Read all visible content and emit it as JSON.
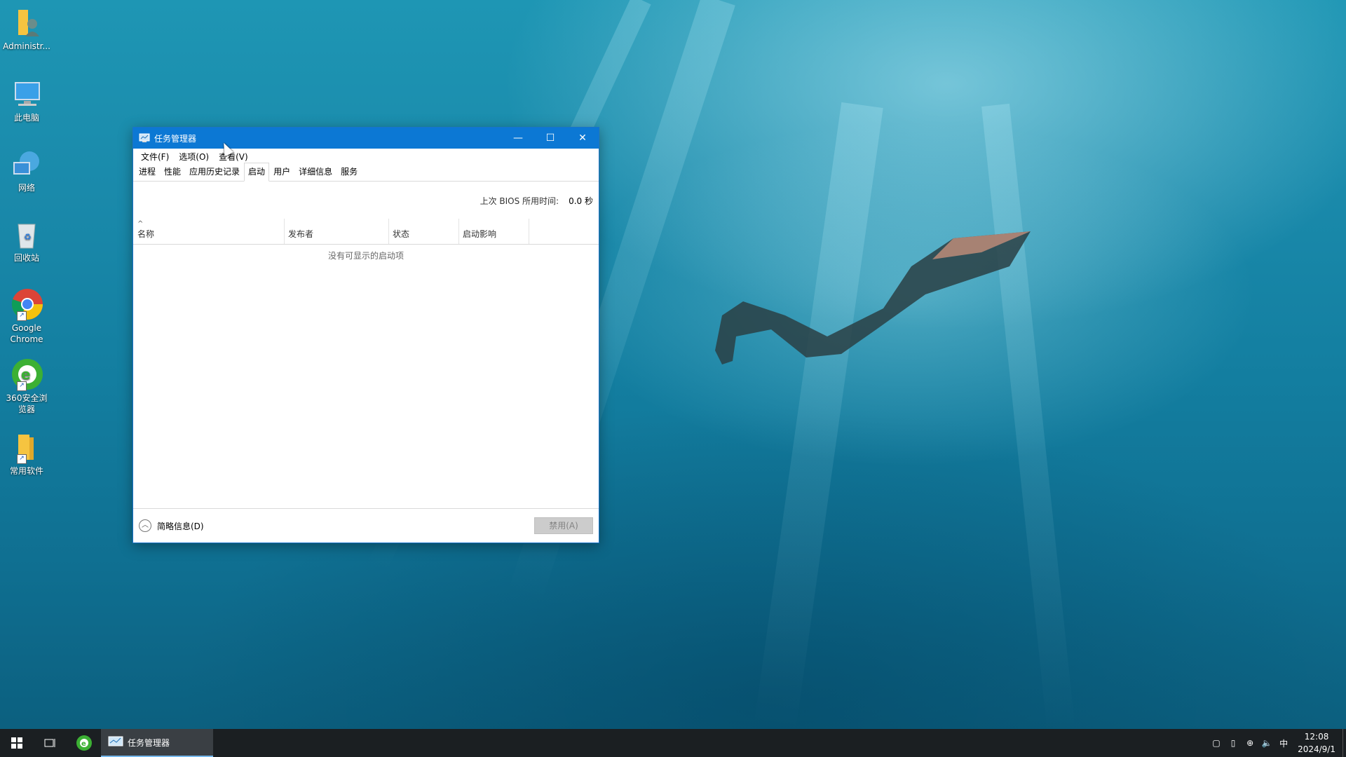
{
  "desktop": {
    "icons": [
      {
        "label": "Administr...",
        "icon": "user-folder-icon"
      },
      {
        "label": "此电脑",
        "icon": "computer-icon"
      },
      {
        "label": "网络",
        "icon": "network-icon"
      },
      {
        "label": "回收站",
        "icon": "recycle-bin-icon"
      },
      {
        "label": "Google Chrome",
        "icon": "chrome-icon"
      },
      {
        "label": "360安全浏览器",
        "icon": "360-browser-icon"
      },
      {
        "label": "常用软件",
        "icon": "folder-icon"
      }
    ]
  },
  "window": {
    "title": "任务管理器",
    "controls": {
      "minimize": "—",
      "maximize": "☐",
      "close": "✕"
    },
    "menu": [
      "文件(F)",
      "选项(O)",
      "查看(V)"
    ],
    "tabs": [
      "进程",
      "性能",
      "应用历史记录",
      "启动",
      "用户",
      "详细信息",
      "服务"
    ],
    "active_tab": "启动",
    "bios_label": "上次 BIOS 所用时间:",
    "bios_value": "0.0 秒",
    "columns": [
      "名称",
      "发布者",
      "状态",
      "启动影响"
    ],
    "empty_message": "没有可显示的启动项",
    "footer": {
      "summary_label": "简略信息(D)",
      "disable_label": "禁用(A)"
    }
  },
  "taskbar": {
    "app_label": "任务管理器",
    "ime": "中",
    "time": "12:08",
    "date": "2024/9/1"
  },
  "colors": {
    "accent": "#0c78d4",
    "taskbar": "#1b1f22"
  }
}
